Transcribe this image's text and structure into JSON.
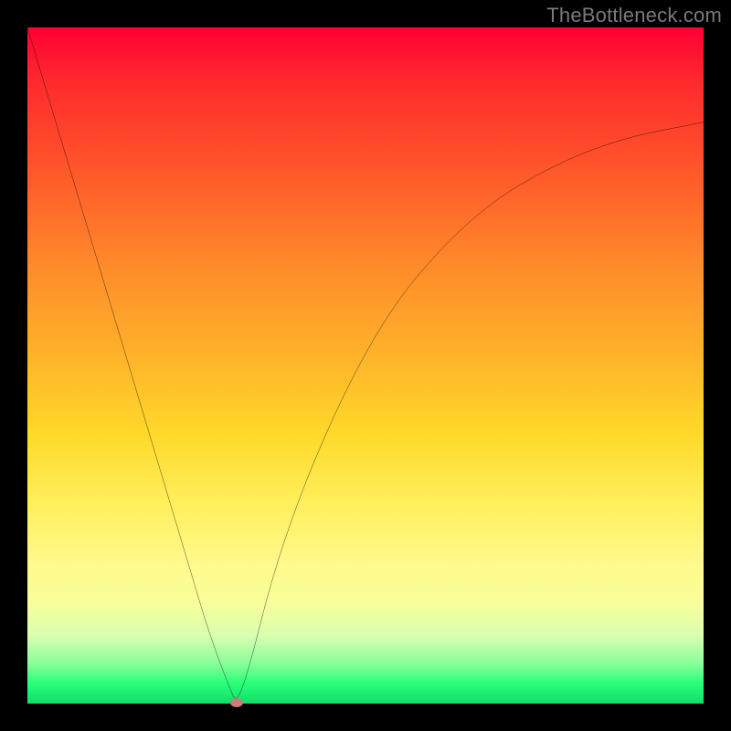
{
  "watermark": "TheBottleneck.com",
  "chart_data": {
    "type": "line",
    "title": "",
    "xlabel": "",
    "ylabel": "",
    "xlim": [
      0,
      100
    ],
    "ylim": [
      0,
      100
    ],
    "grid": false,
    "legend": false,
    "series": [
      {
        "name": "bottleneck-curve",
        "x": [
          0,
          3,
          6,
          9,
          12,
          15,
          18,
          21,
          24,
          27,
          30,
          31,
          33,
          36,
          40,
          45,
          50,
          55,
          60,
          65,
          70,
          75,
          80,
          85,
          90,
          95,
          100
        ],
        "y": [
          100,
          90,
          80,
          70,
          60,
          50,
          40,
          30,
          20,
          10,
          2,
          0,
          6,
          18,
          30,
          42,
          52,
          60,
          66,
          71,
          75,
          78,
          80.5,
          82.5,
          84,
          85,
          86
        ]
      }
    ],
    "annotations": [
      {
        "name": "optimal-point",
        "x": 31,
        "y": 0,
        "marker": "ellipse",
        "color": "#cc7a7a"
      }
    ],
    "background_gradient": {
      "direction": "vertical",
      "stops": [
        {
          "pos": 0.0,
          "color": "#ff0033"
        },
        {
          "pos": 0.5,
          "color": "#ffb12a"
        },
        {
          "pos": 0.8,
          "color": "#fff98a"
        },
        {
          "pos": 1.0,
          "color": "#14db6a"
        }
      ]
    }
  }
}
